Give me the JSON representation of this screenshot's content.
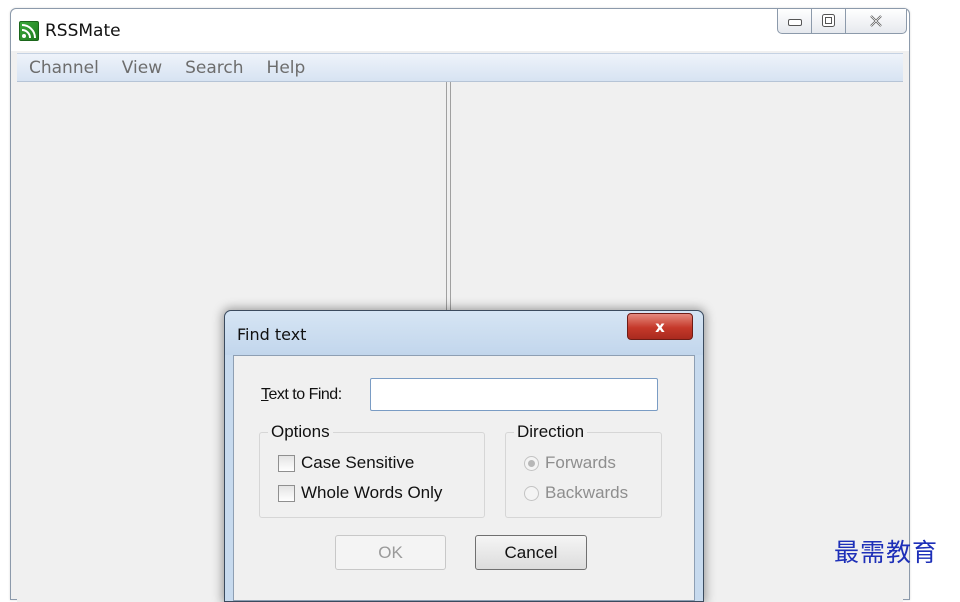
{
  "window": {
    "title": "RSSMate",
    "controls": {
      "minimize": "▭",
      "maximize": "▣",
      "close": "✕"
    }
  },
  "menu": {
    "items": [
      "Channel",
      "View",
      "Search",
      "Help"
    ]
  },
  "dialog": {
    "title": "Find text",
    "close": "x",
    "text_to_find": {
      "label_accel": "T",
      "label_rest": "ext to Find:",
      "value": "",
      "placeholder": ""
    },
    "options": {
      "legend": "Options",
      "case_sensitive": {
        "label": "Case Sensitive",
        "checked": false
      },
      "whole_words_only": {
        "label": "Whole Words Only",
        "checked": false
      }
    },
    "direction": {
      "legend": "Direction",
      "forwards": {
        "label": "Forwards",
        "selected": true,
        "enabled": false
      },
      "backwards": {
        "label": "Backwards",
        "selected": false,
        "enabled": false
      }
    },
    "buttons": {
      "ok": "OK",
      "cancel": "Cancel"
    }
  },
  "watermark": "最需教育",
  "colors": {
    "menu_bar": "#d7e3f2",
    "dialog_frame": "#c7daee",
    "close_button": "#c5392a",
    "watermark": "#1d2fb8"
  },
  "icons": [
    "rss-feed-icon",
    "minimize-icon",
    "maximize-icon",
    "close-icon"
  ]
}
